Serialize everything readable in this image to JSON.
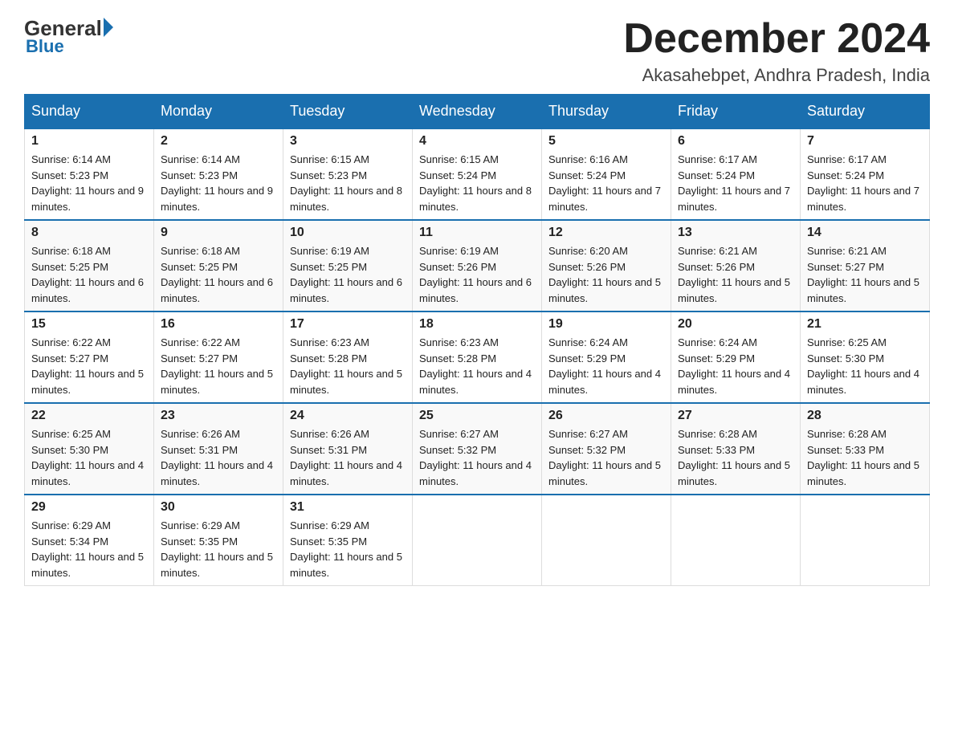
{
  "header": {
    "logo_general": "General",
    "logo_blue": "Blue",
    "main_title": "December 2024",
    "subtitle": "Akasahebpet, Andhra Pradesh, India"
  },
  "calendar": {
    "days_of_week": [
      "Sunday",
      "Monday",
      "Tuesday",
      "Wednesday",
      "Thursday",
      "Friday",
      "Saturday"
    ],
    "weeks": [
      [
        {
          "day": "1",
          "sunrise": "6:14 AM",
          "sunset": "5:23 PM",
          "daylight": "11 hours and 9 minutes."
        },
        {
          "day": "2",
          "sunrise": "6:14 AM",
          "sunset": "5:23 PM",
          "daylight": "11 hours and 9 minutes."
        },
        {
          "day": "3",
          "sunrise": "6:15 AM",
          "sunset": "5:23 PM",
          "daylight": "11 hours and 8 minutes."
        },
        {
          "day": "4",
          "sunrise": "6:15 AM",
          "sunset": "5:24 PM",
          "daylight": "11 hours and 8 minutes."
        },
        {
          "day": "5",
          "sunrise": "6:16 AM",
          "sunset": "5:24 PM",
          "daylight": "11 hours and 7 minutes."
        },
        {
          "day": "6",
          "sunrise": "6:17 AM",
          "sunset": "5:24 PM",
          "daylight": "11 hours and 7 minutes."
        },
        {
          "day": "7",
          "sunrise": "6:17 AM",
          "sunset": "5:24 PM",
          "daylight": "11 hours and 7 minutes."
        }
      ],
      [
        {
          "day": "8",
          "sunrise": "6:18 AM",
          "sunset": "5:25 PM",
          "daylight": "11 hours and 6 minutes."
        },
        {
          "day": "9",
          "sunrise": "6:18 AM",
          "sunset": "5:25 PM",
          "daylight": "11 hours and 6 minutes."
        },
        {
          "day": "10",
          "sunrise": "6:19 AM",
          "sunset": "5:25 PM",
          "daylight": "11 hours and 6 minutes."
        },
        {
          "day": "11",
          "sunrise": "6:19 AM",
          "sunset": "5:26 PM",
          "daylight": "11 hours and 6 minutes."
        },
        {
          "day": "12",
          "sunrise": "6:20 AM",
          "sunset": "5:26 PM",
          "daylight": "11 hours and 5 minutes."
        },
        {
          "day": "13",
          "sunrise": "6:21 AM",
          "sunset": "5:26 PM",
          "daylight": "11 hours and 5 minutes."
        },
        {
          "day": "14",
          "sunrise": "6:21 AM",
          "sunset": "5:27 PM",
          "daylight": "11 hours and 5 minutes."
        }
      ],
      [
        {
          "day": "15",
          "sunrise": "6:22 AM",
          "sunset": "5:27 PM",
          "daylight": "11 hours and 5 minutes."
        },
        {
          "day": "16",
          "sunrise": "6:22 AM",
          "sunset": "5:27 PM",
          "daylight": "11 hours and 5 minutes."
        },
        {
          "day": "17",
          "sunrise": "6:23 AM",
          "sunset": "5:28 PM",
          "daylight": "11 hours and 5 minutes."
        },
        {
          "day": "18",
          "sunrise": "6:23 AM",
          "sunset": "5:28 PM",
          "daylight": "11 hours and 4 minutes."
        },
        {
          "day": "19",
          "sunrise": "6:24 AM",
          "sunset": "5:29 PM",
          "daylight": "11 hours and 4 minutes."
        },
        {
          "day": "20",
          "sunrise": "6:24 AM",
          "sunset": "5:29 PM",
          "daylight": "11 hours and 4 minutes."
        },
        {
          "day": "21",
          "sunrise": "6:25 AM",
          "sunset": "5:30 PM",
          "daylight": "11 hours and 4 minutes."
        }
      ],
      [
        {
          "day": "22",
          "sunrise": "6:25 AM",
          "sunset": "5:30 PM",
          "daylight": "11 hours and 4 minutes."
        },
        {
          "day": "23",
          "sunrise": "6:26 AM",
          "sunset": "5:31 PM",
          "daylight": "11 hours and 4 minutes."
        },
        {
          "day": "24",
          "sunrise": "6:26 AM",
          "sunset": "5:31 PM",
          "daylight": "11 hours and 4 minutes."
        },
        {
          "day": "25",
          "sunrise": "6:27 AM",
          "sunset": "5:32 PM",
          "daylight": "11 hours and 4 minutes."
        },
        {
          "day": "26",
          "sunrise": "6:27 AM",
          "sunset": "5:32 PM",
          "daylight": "11 hours and 5 minutes."
        },
        {
          "day": "27",
          "sunrise": "6:28 AM",
          "sunset": "5:33 PM",
          "daylight": "11 hours and 5 minutes."
        },
        {
          "day": "28",
          "sunrise": "6:28 AM",
          "sunset": "5:33 PM",
          "daylight": "11 hours and 5 minutes."
        }
      ],
      [
        {
          "day": "29",
          "sunrise": "6:29 AM",
          "sunset": "5:34 PM",
          "daylight": "11 hours and 5 minutes."
        },
        {
          "day": "30",
          "sunrise": "6:29 AM",
          "sunset": "5:35 PM",
          "daylight": "11 hours and 5 minutes."
        },
        {
          "day": "31",
          "sunrise": "6:29 AM",
          "sunset": "5:35 PM",
          "daylight": "11 hours and 5 minutes."
        },
        null,
        null,
        null,
        null
      ]
    ]
  }
}
